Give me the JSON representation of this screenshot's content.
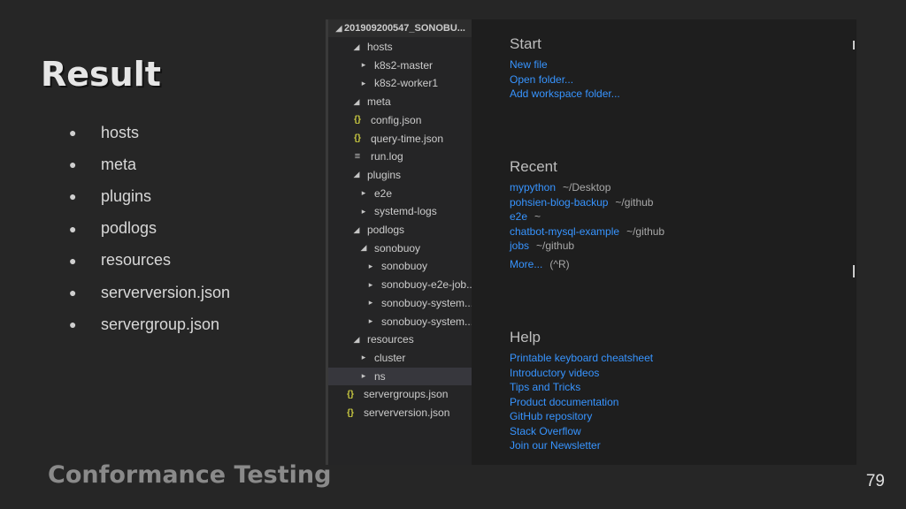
{
  "slide": {
    "title": "Result",
    "bullets": [
      "hosts",
      "meta",
      "plugins",
      "podlogs",
      "resources",
      "serverversion.json",
      "servergroup.json"
    ],
    "footer": "Conformance Testing",
    "page_number": "79"
  },
  "explorer": {
    "root": "201909200547_SONOBU...",
    "items": [
      {
        "label": "hosts",
        "icon": "chevron-down-icon",
        "glyph": "◢"
      },
      {
        "label": "k8s2-master",
        "icon": "chevron-right-icon",
        "glyph": "▸"
      },
      {
        "label": "k8s2-worker1",
        "icon": "chevron-right-icon",
        "glyph": "▸"
      },
      {
        "label": "meta",
        "icon": "chevron-down-icon",
        "glyph": "◢"
      },
      {
        "label": "config.json",
        "icon": "json-file-icon",
        "glyph": "{}"
      },
      {
        "label": "query-time.json",
        "icon": "json-file-icon",
        "glyph": "{}"
      },
      {
        "label": "run.log",
        "icon": "log-file-icon",
        "glyph": "≡"
      },
      {
        "label": "plugins",
        "icon": "chevron-down-icon",
        "glyph": "◢"
      },
      {
        "label": "e2e",
        "icon": "chevron-right-icon",
        "glyph": "▸"
      },
      {
        "label": "systemd-logs",
        "icon": "chevron-right-icon",
        "glyph": "▸"
      },
      {
        "label": "podlogs",
        "icon": "chevron-down-icon",
        "glyph": "◢"
      },
      {
        "label": "sonobuoy",
        "icon": "chevron-down-icon",
        "glyph": "◢"
      },
      {
        "label": "sonobuoy",
        "icon": "chevron-right-icon",
        "glyph": "▸"
      },
      {
        "label": "sonobuoy-e2e-job...",
        "icon": "chevron-right-icon",
        "glyph": "▸"
      },
      {
        "label": "sonobuoy-system...",
        "icon": "chevron-right-icon",
        "glyph": "▸"
      },
      {
        "label": "sonobuoy-system...",
        "icon": "chevron-right-icon",
        "glyph": "▸"
      },
      {
        "label": "resources",
        "icon": "chevron-down-icon",
        "glyph": "◢"
      },
      {
        "label": "cluster",
        "icon": "chevron-right-icon",
        "glyph": "▸"
      },
      {
        "label": "ns",
        "icon": "chevron-right-icon",
        "glyph": "▸"
      },
      {
        "label": "servergroups.json",
        "icon": "json-file-icon",
        "glyph": "{}"
      },
      {
        "label": "serverversion.json",
        "icon": "json-file-icon",
        "glyph": "{}"
      }
    ]
  },
  "welcome": {
    "start": {
      "heading": "Start",
      "links": [
        "New file",
        "Open folder...",
        "Add workspace folder..."
      ]
    },
    "recent": {
      "heading": "Recent",
      "items": [
        {
          "name": "mypython",
          "path": "~/Desktop"
        },
        {
          "name": "pohsien-blog-backup",
          "path": "~/github"
        },
        {
          "name": "e2e",
          "path": "~"
        },
        {
          "name": "chatbot-mysql-example",
          "path": "~/github"
        },
        {
          "name": "jobs",
          "path": "~/github"
        }
      ],
      "more": "More...",
      "more_hint": "(^R)"
    },
    "help": {
      "heading": "Help",
      "links": [
        "Printable keyboard cheatsheet",
        "Introductory videos",
        "Tips and Tricks",
        "Product documentation",
        "GitHub repository",
        "Stack Overflow",
        "Join our Newsletter"
      ]
    }
  },
  "colors": {
    "link": "#3794ff",
    "background": "#262626",
    "editor": "#1e1e1e",
    "sidebar": "#252526"
  }
}
